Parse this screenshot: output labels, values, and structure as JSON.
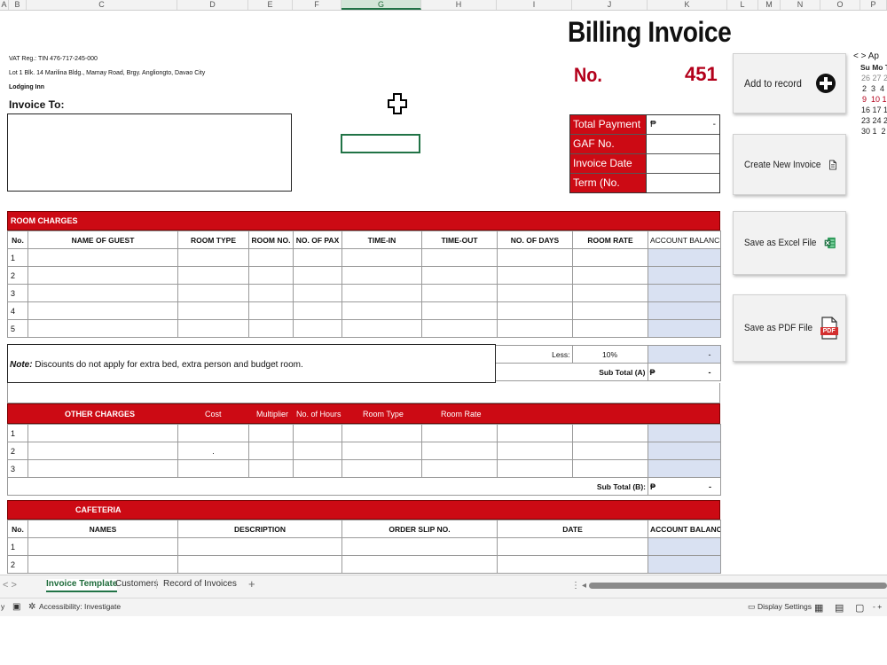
{
  "column_headers": [
    "A",
    "B",
    "C",
    "D",
    "E",
    "F",
    "G",
    "H",
    "I",
    "J",
    "K",
    "L",
    "M",
    "N",
    "O",
    "P"
  ],
  "company": {
    "vat": "VAT Reg.: TIN 476-717-245-000",
    "address": "Lot 1 Blk. 14 Marilina Bldg., Mamay Road, Brgy. Angliongto, Davao City",
    "name": "Lodging Inn"
  },
  "invoice_to_label": "Invoice To:",
  "title": "Billing Invoice",
  "number": {
    "label": "No.",
    "value": "451"
  },
  "info": {
    "total_payment": {
      "label": "Total Payment",
      "currency": "₱",
      "dash": "-"
    },
    "gaf_label": "GAF No.",
    "date_label": "Invoice Date",
    "term_label": "Term (No. Days)"
  },
  "room_charges": {
    "section_title": "ROOM CHARGES",
    "headers": [
      "No.",
      "NAME OF GUEST",
      "ROOM TYPE",
      "ROOM NO.",
      "NO. OF PAX",
      "TIME-IN",
      "TIME-OUT",
      "NO. OF DAYS",
      "ROOM RATE",
      "ACCOUNT BALANCE"
    ],
    "rows": [
      "1",
      "2",
      "3",
      "4",
      "5"
    ],
    "note_prefix": "Note:",
    "note_text": " Discounts do not apply for extra bed, extra person and budget room.",
    "less_label": "Less:",
    "less_value": "10%",
    "less_dash": "-",
    "subtotal_label": "Sub Total (A)",
    "currency": "₱",
    "subtotal_dash": "-"
  },
  "other_charges": {
    "headers": [
      "OTHER CHARGES",
      "Cost",
      "Multiplier",
      "No. of Hours",
      "Room Type",
      "Room Rate"
    ],
    "rows": [
      "1",
      "2",
      "3"
    ],
    "dot": ".",
    "subtotal_label": "Sub Total (B):",
    "currency": "₱",
    "subtotal_dash": "-"
  },
  "cafeteria": {
    "section_title": "CAFETERIA",
    "headers": [
      "No.",
      "NAMES",
      "DESCRIPTION",
      "ORDER SLIP NO.",
      "DATE",
      "ACCOUNT BALANCE"
    ],
    "rows": [
      "1",
      "2"
    ]
  },
  "buttons": {
    "add_record": "Add to record",
    "new_invoice": "Create New Invoice",
    "save_excel": "Save as Excel File",
    "save_pdf": "Save as PDF File",
    "pdf_badge": "PDF"
  },
  "calendar": {
    "nav": "< >",
    "month": "Ap",
    "dow": "Su Mo T",
    "weeks": [
      "26 27 2",
      "2  3  4",
      "9  10 1",
      "16 17 1",
      "23 24 2",
      "30 1  2"
    ]
  },
  "sheet_tabs": [
    "Invoice Template",
    "Customers",
    "Record of Invoices"
  ],
  "tab_nav": "<  >",
  "tab_add": "+",
  "status": {
    "left": "y",
    "accessibility": "Accessibility: Investigate",
    "display": "Display Settings",
    "zoom": "- +"
  }
}
